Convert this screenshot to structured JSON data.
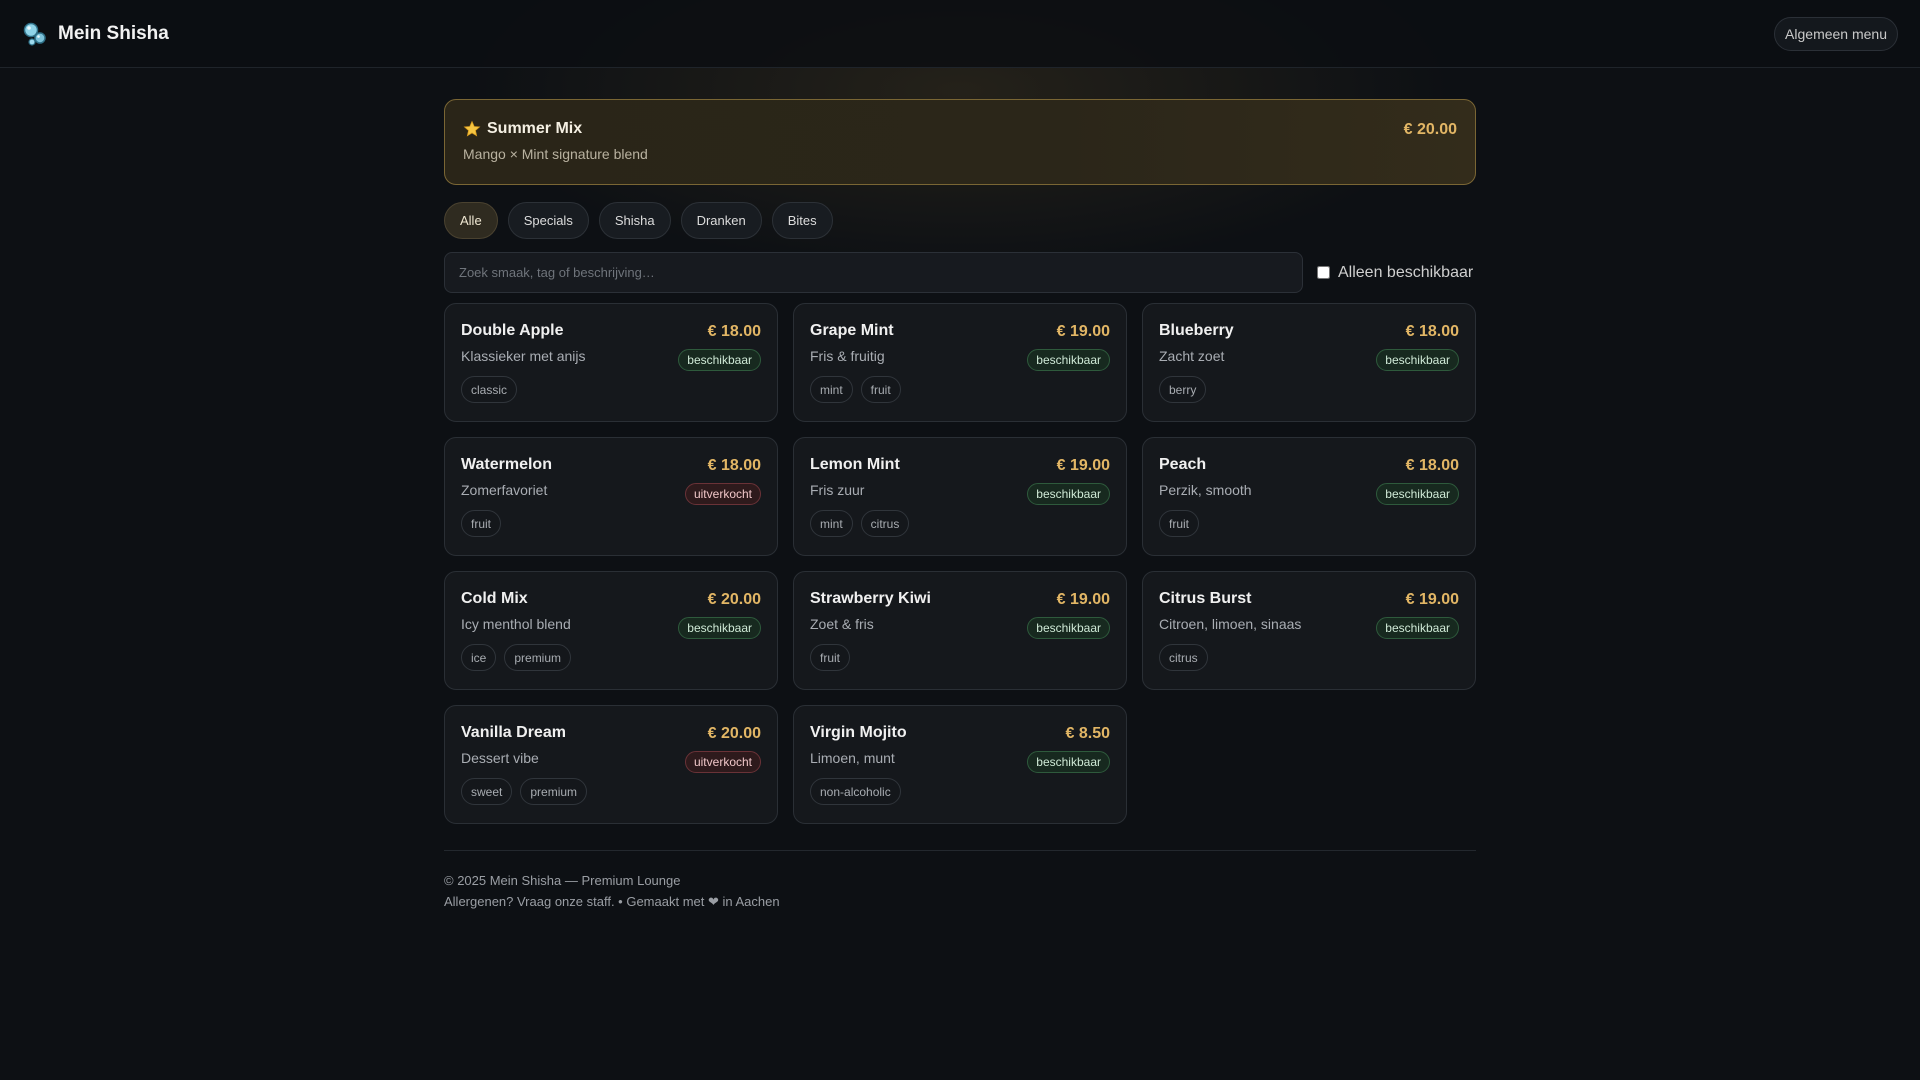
{
  "header": {
    "brand": "Mein Shisha",
    "brand_icon": "bubbles-icon",
    "menu_label": "Algemeen menu"
  },
  "featured": {
    "icon": "star-icon",
    "title": "Summer Mix",
    "description": "Mango × Mint signature blend",
    "price": "€ 20.00"
  },
  "tabs": [
    {
      "label": "Alle",
      "active": true
    },
    {
      "label": "Specials",
      "active": false
    },
    {
      "label": "Shisha",
      "active": false
    },
    {
      "label": "Dranken",
      "active": false
    },
    {
      "label": "Bites",
      "active": false
    }
  ],
  "search": {
    "placeholder": "Zoek smaak, tag of beschrijving…",
    "value": ""
  },
  "filter": {
    "available_only_label": "Alleen beschikbaar",
    "checked": false
  },
  "items": [
    {
      "name": "Double Apple",
      "price": "€ 18.00",
      "desc": "Klassieker met anijs",
      "status": "beschikbaar",
      "available": true,
      "tags": [
        "classic"
      ]
    },
    {
      "name": "Grape Mint",
      "price": "€ 19.00",
      "desc": "Fris & fruitig",
      "status": "beschikbaar",
      "available": true,
      "tags": [
        "mint",
        "fruit"
      ]
    },
    {
      "name": "Blueberry",
      "price": "€ 18.00",
      "desc": "Zacht zoet",
      "status": "beschikbaar",
      "available": true,
      "tags": [
        "berry"
      ]
    },
    {
      "name": "Watermelon",
      "price": "€ 18.00",
      "desc": "Zomerfavoriet",
      "status": "uitverkocht",
      "available": false,
      "tags": [
        "fruit"
      ]
    },
    {
      "name": "Lemon Mint",
      "price": "€ 19.00",
      "desc": "Fris zuur",
      "status": "beschikbaar",
      "available": true,
      "tags": [
        "mint",
        "citrus"
      ]
    },
    {
      "name": "Peach",
      "price": "€ 18.00",
      "desc": "Perzik, smooth",
      "status": "beschikbaar",
      "available": true,
      "tags": [
        "fruit"
      ]
    },
    {
      "name": "Cold Mix",
      "price": "€ 20.00",
      "desc": "Icy menthol blend",
      "status": "beschikbaar",
      "available": true,
      "tags": [
        "ice",
        "premium"
      ]
    },
    {
      "name": "Strawberry Kiwi",
      "price": "€ 19.00",
      "desc": "Zoet & fris",
      "status": "beschikbaar",
      "available": true,
      "tags": [
        "fruit"
      ]
    },
    {
      "name": "Citrus Burst",
      "price": "€ 19.00",
      "desc": "Citroen, limoen, sinaas",
      "status": "beschikbaar",
      "available": true,
      "tags": [
        "citrus"
      ]
    },
    {
      "name": "Vanilla Dream",
      "price": "€ 20.00",
      "desc": "Dessert vibe",
      "status": "uitverkocht",
      "available": false,
      "tags": [
        "sweet",
        "premium"
      ]
    },
    {
      "name": "Virgin Mojito",
      "price": "€ 8.50",
      "desc": "Limoen, munt",
      "status": "beschikbaar",
      "available": true,
      "tags": [
        "non-alcoholic"
      ]
    }
  ],
  "footer": {
    "line1": "© 2025 Mein Shisha — Premium Lounge",
    "line2": "Allergenen? Vraag onze staff. • Gemaakt met ❤ in Aachen"
  },
  "colors": {
    "accent_gold": "#e2b665",
    "available_green": "#2e5a3c",
    "sold_out_red": "#6a3237",
    "background": "#0d1014"
  }
}
